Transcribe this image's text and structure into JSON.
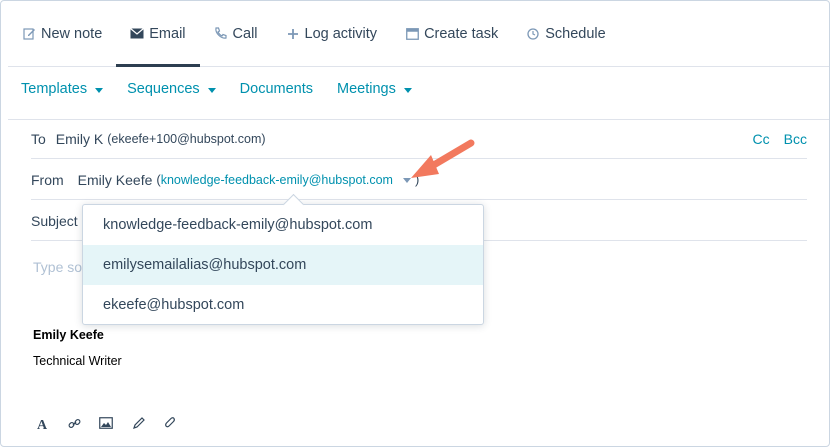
{
  "tabs": [
    {
      "label": "New note",
      "icon": "pencil-icon"
    },
    {
      "label": "Email",
      "icon": "envelope-icon",
      "active": true
    },
    {
      "label": "Call",
      "icon": "phone-icon"
    },
    {
      "label": "Log activity",
      "icon": "plus-icon"
    },
    {
      "label": "Create task",
      "icon": "task-icon"
    },
    {
      "label": "Schedule",
      "icon": "clock-icon"
    }
  ],
  "toolbar": {
    "templates": "Templates",
    "sequences": "Sequences",
    "documents": "Documents",
    "meetings": "Meetings"
  },
  "to": {
    "label": "To",
    "name": "Emily K",
    "email": "(ekeefe+100@hubspot.com)",
    "cc": "Cc",
    "bcc": "Bcc"
  },
  "from": {
    "label": "From",
    "name": "Emily Keefe",
    "open_paren": "(",
    "email": "knowledge-feedback-emily@hubspot.com",
    "close_paren": ")"
  },
  "subject": {
    "label": "Subject"
  },
  "body": {
    "placeholder": "Type so"
  },
  "signature": {
    "name": "Emily Keefe",
    "title": "Technical Writer"
  },
  "from_dropdown": {
    "options": [
      "knowledge-feedback-emily@hubspot.com",
      "emilysemailalias@hubspot.com",
      "ekeefe@hubspot.com"
    ],
    "hovered_index": 1
  },
  "colors": {
    "accent": "#0091ae",
    "text": "#33475b",
    "annotation_arrow": "#f2795e",
    "hover": "#e5f5f8"
  }
}
